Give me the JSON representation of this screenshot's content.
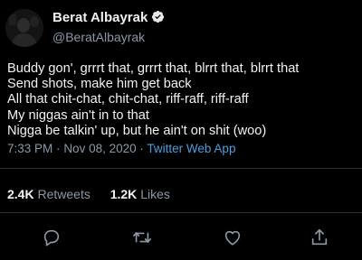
{
  "author": {
    "display_name": "Berat Albayrak",
    "handle": "@BeratAlbayrak",
    "avatar_icon": "profile-photo",
    "verified_icon": "verified-badge-icon"
  },
  "tweet": {
    "lines": [
      "Buddy gon', grrrt that, grrrt that, blrrt that, blrrt that",
      "Send shots, make him get back",
      "All that chit-chat, chit-chat, riff-raff, riff-raff",
      "My niggas ain't in to that",
      "Nigga be talkin' up, but he ain't on shit (woo)"
    ],
    "time": "7:33 PM",
    "separator": "·",
    "date": "Nov 08, 2020",
    "app": "Twitter Web App"
  },
  "stats": {
    "retweets_count": "2.4K",
    "retweets_label": "Retweets",
    "likes_count": "1.2K",
    "likes_label": "Likes"
  },
  "actions": [
    "reply-icon",
    "retweet-icon",
    "like-icon",
    "share-icon"
  ],
  "colors": {
    "background": "#000000",
    "text": "#f2f2f2",
    "muted": "#8b98a5",
    "link": "#4d9fe0",
    "verified": "#1d9bf0"
  }
}
